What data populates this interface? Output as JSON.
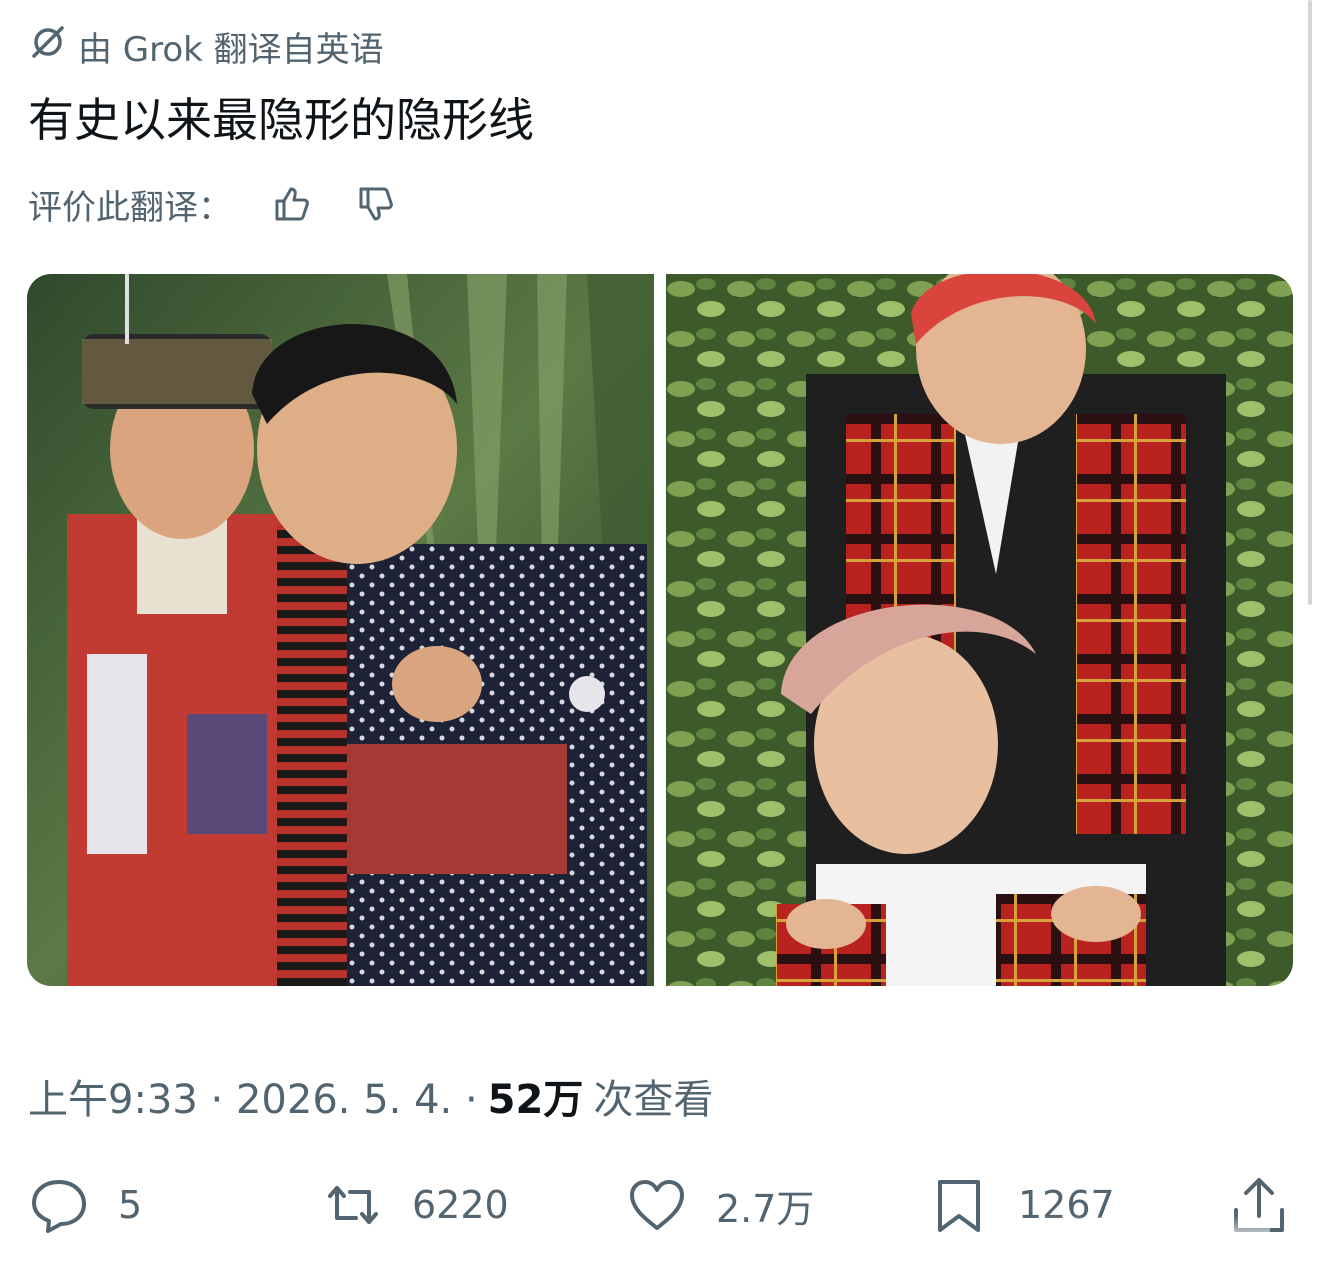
{
  "translation": {
    "label": "由 Grok 翻译自英语",
    "icon": "grok-icon"
  },
  "tweet": {
    "text": "有史以来最隐形的隐形线"
  },
  "rating": {
    "label": "评价此翻译：",
    "up_icon": "thumbs-up-icon",
    "down_icon": "thumbs-down-icon"
  },
  "media": {
    "count": 2
  },
  "meta": {
    "time_date": "上午9:33 · 2026. 5. 4. ·",
    "views_value": "52万",
    "views_label": "次查看"
  },
  "actions": {
    "replies": "5",
    "reposts": "6220",
    "likes": "2.7万",
    "bookmarks": "1267"
  },
  "colors": {
    "text_primary": "#0f1419",
    "text_secondary": "#536471",
    "background": "#ffffff"
  }
}
